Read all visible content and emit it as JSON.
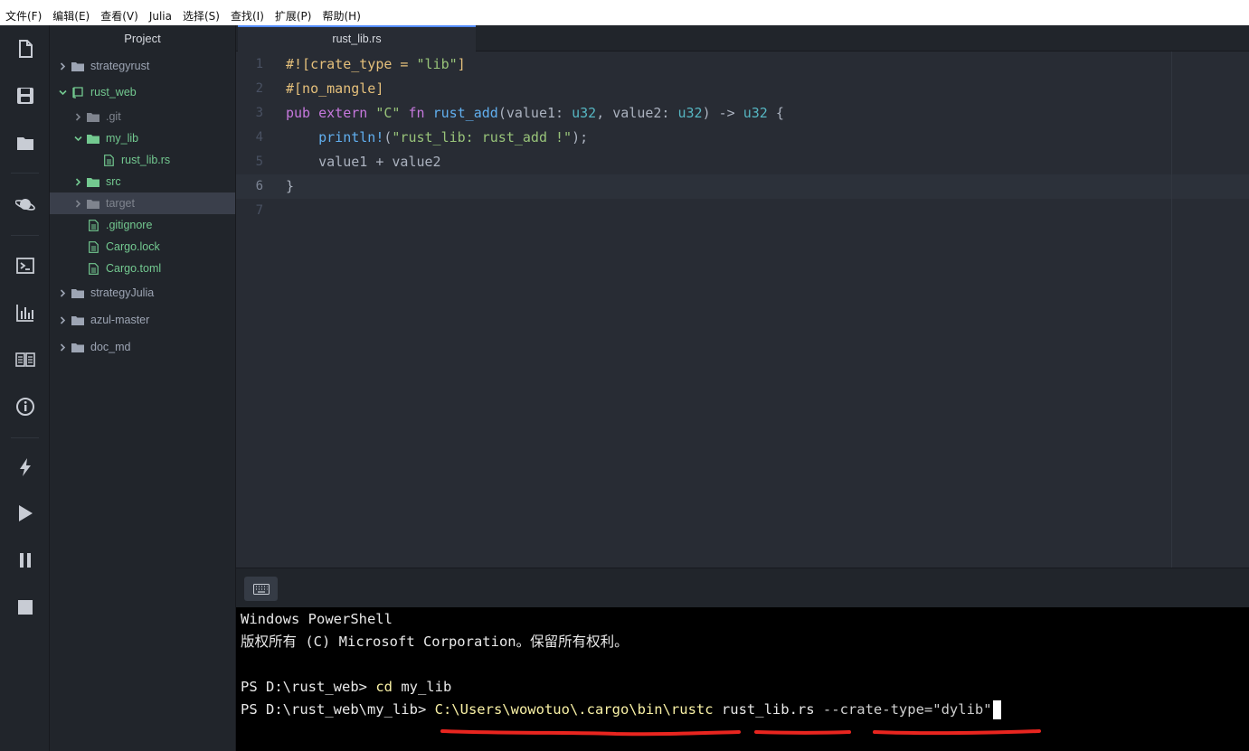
{
  "menu": [
    "文件(F)",
    "编辑(E)",
    "查看(V)",
    "Julia",
    "选择(S)",
    "查找(I)",
    "扩展(P)",
    "帮助(H)"
  ],
  "project": {
    "title": "Project",
    "items": [
      {
        "label": "strategyrust",
        "depth": 0,
        "kind": "folder",
        "open": false,
        "color": "normal"
      },
      {
        "label": "rust_web",
        "depth": 0,
        "kind": "repo",
        "open": true,
        "color": "green"
      },
      {
        "label": ".git",
        "depth": 1,
        "kind": "folder",
        "open": false,
        "color": "dim"
      },
      {
        "label": "my_lib",
        "depth": 1,
        "kind": "folder",
        "open": true,
        "color": "green"
      },
      {
        "label": "rust_lib.rs",
        "depth": 2,
        "kind": "file",
        "open": false,
        "color": "green"
      },
      {
        "label": "src",
        "depth": 1,
        "kind": "folder",
        "open": false,
        "color": "green"
      },
      {
        "label": "target",
        "depth": 1,
        "kind": "folder",
        "open": false,
        "color": "dim",
        "selected": true
      },
      {
        "label": ".gitignore",
        "depth": 1,
        "kind": "file",
        "open": false,
        "color": "green"
      },
      {
        "label": "Cargo.lock",
        "depth": 1,
        "kind": "file",
        "open": false,
        "color": "green"
      },
      {
        "label": "Cargo.toml",
        "depth": 1,
        "kind": "file",
        "open": false,
        "color": "green"
      },
      {
        "label": "strategyJulia",
        "depth": 0,
        "kind": "folder",
        "open": false,
        "color": "normal"
      },
      {
        "label": "azul-master",
        "depth": 0,
        "kind": "folder",
        "open": false,
        "color": "normal"
      },
      {
        "label": "doc_md",
        "depth": 0,
        "kind": "folder",
        "open": false,
        "color": "normal"
      }
    ]
  },
  "editor": {
    "tab": "rust_lib.rs",
    "line_numbers": [
      "1",
      "2",
      "3",
      "4",
      "5",
      "6",
      "7"
    ],
    "lines": [
      {
        "l1": "#![crate_type = ",
        "l2": "\"lib\"",
        "l3": "]"
      },
      {
        "l1": "#[no_mangle]"
      },
      {
        "kw1": "pub ",
        "kw2": "extern ",
        "s1": "\"C\"",
        "kw3": " fn ",
        "fn": "rust_add",
        "p1": "(value1: ",
        "t1": "u32",
        "p2": ", value2: ",
        "t2": "u32",
        "p3": ") -> ",
        "t3": "u32",
        "p4": " {"
      },
      {
        "indent": "    ",
        "fn": "println!",
        "p1": "(",
        "s1": "\"rust_lib: rust_add !\"",
        "p2": ");"
      },
      {
        "text": "    value1 + value2"
      },
      {
        "text": "}"
      },
      {
        "text": ""
      }
    ]
  },
  "terminal": {
    "line1": "Windows PowerShell",
    "line2": "版权所有 (C) Microsoft Corporation。保留所有权利。",
    "line4_prompt": "PS D:\\rust_web> ",
    "line4_cmd": "cd",
    "line4_arg": " my_lib",
    "line5_prompt": "PS D:\\rust_web\\my_lib> ",
    "line5_cmd": "C:\\Users\\wowotuo\\.cargo\\bin\\rustc",
    "line5_arg1": " rust_lib.rs ",
    "line5_flag": "--crate-type=",
    "line5_val": "\"dylib\""
  },
  "icons": [
    "file-icon",
    "save-icon",
    "folder-icon",
    "planet-icon",
    "terminal-icon",
    "chart-icon",
    "book-icon",
    "info-icon",
    "bolt-icon",
    "play-icon",
    "pause-icon",
    "stop-icon",
    "keyboard-icon"
  ],
  "colors": {
    "annotation": "#e8251f",
    "accent": "#528bff"
  }
}
